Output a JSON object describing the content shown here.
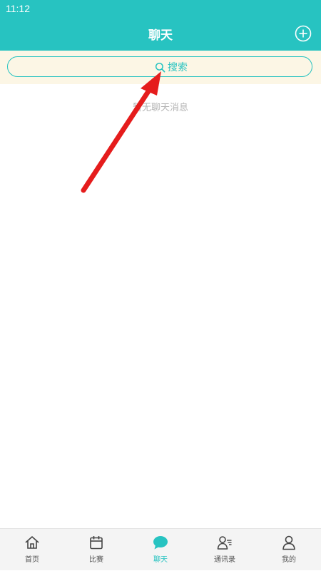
{
  "status_bar": {
    "time": "11:12"
  },
  "header": {
    "title": "聊天"
  },
  "search": {
    "label": "搜索"
  },
  "main": {
    "empty_text": "暂无聊天消息"
  },
  "tabbar": {
    "tabs": [
      {
        "label": "首页",
        "icon": "home-icon"
      },
      {
        "label": "比赛",
        "icon": "calendar-icon"
      },
      {
        "label": "聊天",
        "icon": "chat-bubble-icon",
        "active": true
      },
      {
        "label": "通讯录",
        "icon": "contacts-icon"
      },
      {
        "label": "我的",
        "icon": "profile-icon"
      }
    ]
  },
  "colors": {
    "accent": "#27c3c1",
    "search_bg": "#fcf6e5",
    "annotation_arrow": "#e51c1c"
  }
}
